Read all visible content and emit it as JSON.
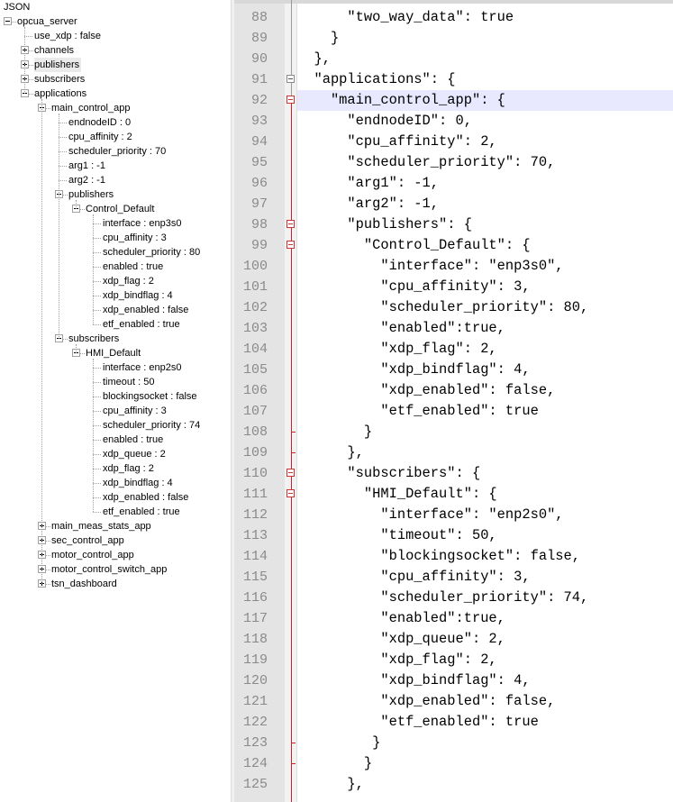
{
  "tree": {
    "title": "JSON",
    "nodes": [
      {
        "label": "opcua_server",
        "expander": "open"
      },
      {
        "label": "use_xdp : false",
        "expander": "none"
      },
      {
        "label": "channels",
        "expander": "closed"
      },
      {
        "label": "publishers",
        "expander": "closed",
        "selected": true
      },
      {
        "label": "subscribers",
        "expander": "closed"
      },
      {
        "label": "applications",
        "expander": "open"
      },
      {
        "label": "main_control_app",
        "expander": "open"
      },
      {
        "label": "endnodeID : 0",
        "expander": "none"
      },
      {
        "label": "cpu_affinity : 2",
        "expander": "none"
      },
      {
        "label": "scheduler_priority : 70",
        "expander": "none"
      },
      {
        "label": "arg1 : -1",
        "expander": "none"
      },
      {
        "label": "arg2 : -1",
        "expander": "none"
      },
      {
        "label": "publishers",
        "expander": "open"
      },
      {
        "label": "Control_Default",
        "expander": "open"
      },
      {
        "label": "interface : enp3s0",
        "expander": "none"
      },
      {
        "label": "cpu_affinity : 3",
        "expander": "none"
      },
      {
        "label": "scheduler_priority : 80",
        "expander": "none"
      },
      {
        "label": "enabled : true",
        "expander": "none"
      },
      {
        "label": "xdp_flag : 2",
        "expander": "none"
      },
      {
        "label": "xdp_bindflag : 4",
        "expander": "none"
      },
      {
        "label": "xdp_enabled : false",
        "expander": "none"
      },
      {
        "label": "etf_enabled : true",
        "expander": "none"
      },
      {
        "label": "subscribers",
        "expander": "open"
      },
      {
        "label": "HMI_Default",
        "expander": "open"
      },
      {
        "label": "interface : enp2s0",
        "expander": "none"
      },
      {
        "label": "timeout : 50",
        "expander": "none"
      },
      {
        "label": "blockingsocket : false",
        "expander": "none"
      },
      {
        "label": "cpu_affinity : 3",
        "expander": "none"
      },
      {
        "label": "scheduler_priority : 74",
        "expander": "none"
      },
      {
        "label": "enabled : true",
        "expander": "none"
      },
      {
        "label": "xdp_queue : 2",
        "expander": "none"
      },
      {
        "label": "xdp_flag : 2",
        "expander": "none"
      },
      {
        "label": "xdp_bindflag : 4",
        "expander": "none"
      },
      {
        "label": "xdp_enabled : false",
        "expander": "none"
      },
      {
        "label": "etf_enabled : true",
        "expander": "none"
      },
      {
        "label": "main_meas_stats_app",
        "expander": "closed"
      },
      {
        "label": "sec_control_app",
        "expander": "closed"
      },
      {
        "label": "motor_control_app",
        "expander": "closed"
      },
      {
        "label": "motor_control_switch_app",
        "expander": "closed"
      },
      {
        "label": "tsn_dashboard",
        "expander": "closed"
      }
    ]
  },
  "editor": {
    "current_line": 92,
    "lines": [
      {
        "n": "88",
        "text": "      \"two_way_data\": true"
      },
      {
        "n": "89",
        "text": "    }"
      },
      {
        "n": "90",
        "text": "  },"
      },
      {
        "n": "91",
        "text": "  \"applications\": {"
      },
      {
        "n": "92",
        "text": "    \"main_control_app\": {"
      },
      {
        "n": "93",
        "text": "      \"endnodeID\": 0,"
      },
      {
        "n": "94",
        "text": "      \"cpu_affinity\": 2,"
      },
      {
        "n": "95",
        "text": "      \"scheduler_priority\": 70,"
      },
      {
        "n": "96",
        "text": "      \"arg1\": -1,"
      },
      {
        "n": "97",
        "text": "      \"arg2\": -1,"
      },
      {
        "n": "98",
        "text": "      \"publishers\": {"
      },
      {
        "n": "99",
        "text": "        \"Control_Default\": {"
      },
      {
        "n": "100",
        "text": "          \"interface\": \"enp3s0\","
      },
      {
        "n": "101",
        "text": "          \"cpu_affinity\": 3,"
      },
      {
        "n": "102",
        "text": "          \"scheduler_priority\": 80,"
      },
      {
        "n": "103",
        "text": "          \"enabled\":true,"
      },
      {
        "n": "104",
        "text": "          \"xdp_flag\": 2,"
      },
      {
        "n": "105",
        "text": "          \"xdp_bindflag\": 4,"
      },
      {
        "n": "106",
        "text": "          \"xdp_enabled\": false,"
      },
      {
        "n": "107",
        "text": "          \"etf_enabled\": true"
      },
      {
        "n": "108",
        "text": "        }"
      },
      {
        "n": "109",
        "text": "      },"
      },
      {
        "n": "110",
        "text": "      \"subscribers\": {"
      },
      {
        "n": "111",
        "text": "        \"HMI_Default\": {"
      },
      {
        "n": "112",
        "text": "          \"interface\": \"enp2s0\","
      },
      {
        "n": "113",
        "text": "          \"timeout\": 50,"
      },
      {
        "n": "114",
        "text": "          \"blockingsocket\": false,"
      },
      {
        "n": "115",
        "text": "          \"cpu_affinity\": 3,"
      },
      {
        "n": "116",
        "text": "          \"scheduler_priority\": 74,"
      },
      {
        "n": "117",
        "text": "          \"enabled\":true,"
      },
      {
        "n": "118",
        "text": "          \"xdp_queue\": 2,"
      },
      {
        "n": "119",
        "text": "          \"xdp_flag\": 2,"
      },
      {
        "n": "120",
        "text": "          \"xdp_bindflag\": 4,"
      },
      {
        "n": "121",
        "text": "          \"xdp_enabled\": false,"
      },
      {
        "n": "122",
        "text": "          \"etf_enabled\": true"
      },
      {
        "n": "123",
        "text": "         }"
      },
      {
        "n": "124",
        "text": "        }"
      },
      {
        "n": "125",
        "text": "      },"
      }
    ]
  }
}
